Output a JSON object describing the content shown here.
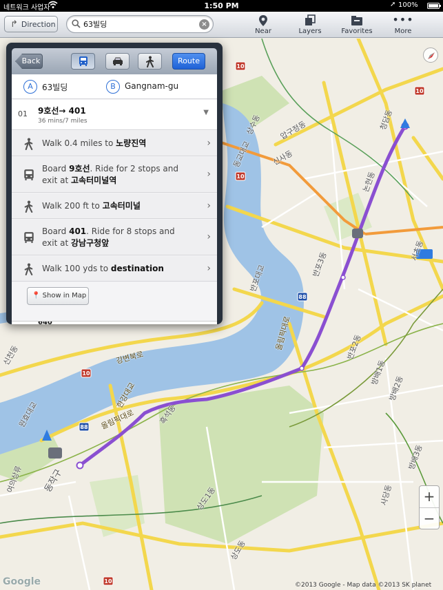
{
  "status_bar": {
    "carrier": "네트워크 사업자",
    "time": "1:50 PM",
    "battery": "100%"
  },
  "toolbar": {
    "direction_label": "Direction",
    "search_value": "63빌딩",
    "buttons": [
      {
        "label": "Near",
        "icon": "pin-icon"
      },
      {
        "label": "Layers",
        "icon": "layers-icon"
      },
      {
        "label": "Favorites",
        "icon": "favorites-icon"
      },
      {
        "label": "More",
        "icon": "more-icon"
      }
    ]
  },
  "directions": {
    "back_label": "Back",
    "route_label": "Route",
    "modes": [
      "transit",
      "driving",
      "walking"
    ],
    "active_mode": "transit",
    "start": {
      "marker": "A",
      "name": "63빌딩"
    },
    "end": {
      "marker": "B",
      "name": "Gangnam-gu"
    },
    "option": {
      "number": "01",
      "title": "9호선→ 401",
      "summary": "36 mins/7 miles"
    },
    "steps": [
      {
        "type": "walk",
        "pre": "Walk 0.4 miles to ",
        "bold": "노량진역",
        "line2_pre": "",
        "line2_bold": ""
      },
      {
        "type": "bus",
        "pre": "Board ",
        "bold": "9호선",
        "post": ". Ride for 2 stops and",
        "line2_pre": "exit at ",
        "line2_bold": "고속터미널역"
      },
      {
        "type": "walk",
        "pre": "Walk 200 ft to ",
        "bold": "고속터미널",
        "line2_pre": "",
        "line2_bold": ""
      },
      {
        "type": "bus",
        "pre": "Board ",
        "bold": "401",
        "post": ". Ride for 8 stops and",
        "line2_pre": "exit at ",
        "line2_bold": "강남구청앞"
      },
      {
        "type": "walk",
        "pre": "Walk 100 yds to ",
        "bold": "destination",
        "line2_pre": "",
        "line2_bold": ""
      }
    ],
    "show_in_map": "Show in Map",
    "next_option_title": "640"
  },
  "map": {
    "labels": [
      "강변북로",
      "한강대교",
      "올림픽대로",
      "흑석동",
      "동작구",
      "여의상류",
      "원효대교",
      "신천동",
      "동교대교",
      "반포대교",
      "올림픽대로",
      "반포3동",
      "반포2동",
      "방배1동",
      "방배2동",
      "방배3동",
      "사당동",
      "서초동",
      "상도1동",
      "상도동",
      "논현동",
      "신사동",
      "압구정동",
      "청담동",
      "상수동"
    ],
    "route_color": "#8a4fd1",
    "attribution": "©2013 Google - Map data ©2013 SK planet",
    "logo": "Google"
  }
}
